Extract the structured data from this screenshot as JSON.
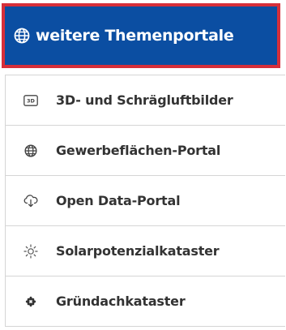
{
  "header": {
    "title": "weitere Themenportale",
    "icon": "globe-icon",
    "background": "#0b4ea2",
    "border_color": "#d62f3a"
  },
  "items": [
    {
      "label": "3D- und Schrägluftbilder",
      "icon": "3d-icon"
    },
    {
      "label": "Gewerbeflächen-Portal",
      "icon": "globe-icon"
    },
    {
      "label": "Open Data-Portal",
      "icon": "cloud-download-icon"
    },
    {
      "label": "Solarpotenzialkataster",
      "icon": "sun-icon"
    },
    {
      "label": "Gründachkataster",
      "icon": "leaf-icon"
    }
  ]
}
